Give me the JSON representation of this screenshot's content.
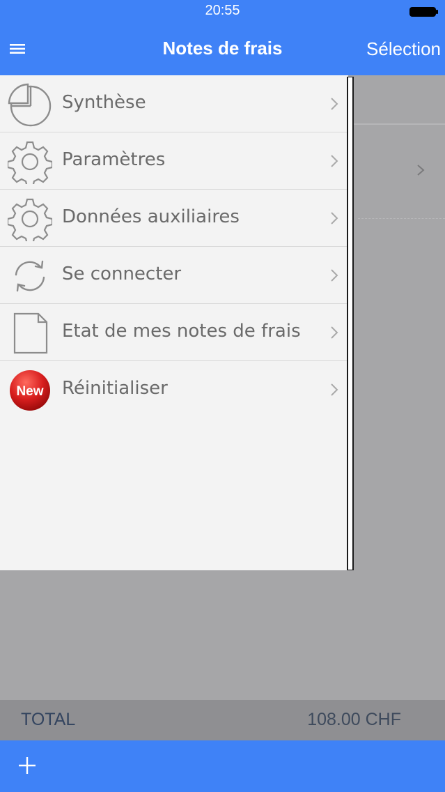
{
  "status": {
    "time": "20:55"
  },
  "header": {
    "title": "Notes de frais",
    "selection_label": "Sélection"
  },
  "menu": {
    "items": [
      {
        "label": "Synthèse",
        "icon": "pie-chart-icon"
      },
      {
        "label": "Paramètres",
        "icon": "gear-icon"
      },
      {
        "label": "Données auxiliaires",
        "icon": "gear-icon"
      },
      {
        "label": "Se connecter",
        "icon": "sync-icon"
      },
      {
        "label": "Etat de mes notes de frais",
        "icon": "document-icon"
      },
      {
        "label": "Réinitialiser",
        "icon": "new-badge-icon",
        "badge": "New"
      }
    ]
  },
  "footer": {
    "total_label": "TOTAL",
    "total_value": "108.00 CHF"
  },
  "colors": {
    "accent": "#3f82f7",
    "drawer_bg": "#f3f3f3",
    "backdrop": "#a6a6a8",
    "badge_red": "#d81e1e"
  }
}
